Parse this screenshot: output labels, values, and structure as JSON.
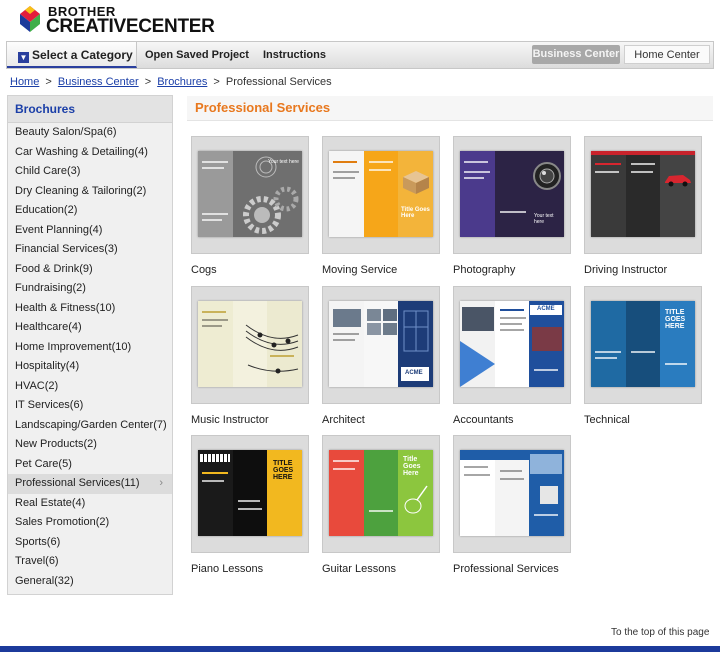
{
  "header": {
    "brand": "BROTHER",
    "product": "CREATIVECENTER"
  },
  "nav": {
    "select_category": "Select a Category",
    "open_saved": "Open Saved Project",
    "instructions": "Instructions",
    "business_center": "Business Center",
    "home_center": "Home Center"
  },
  "breadcrumb": {
    "home": "Home",
    "business": "Business Center",
    "brochures": "Brochures",
    "current": "Professional Services",
    "separator": ">"
  },
  "sidebar": {
    "title": "Brochures",
    "items": [
      {
        "label": "Beauty Salon/Spa(6)"
      },
      {
        "label": "Car Washing & Detailing(4)"
      },
      {
        "label": "Child Care(3)"
      },
      {
        "label": "Dry Cleaning & Tailoring(2)"
      },
      {
        "label": "Education(2)"
      },
      {
        "label": "Event Planning(4)"
      },
      {
        "label": "Financial Services(3)"
      },
      {
        "label": "Food & Drink(9)"
      },
      {
        "label": "Fundraising(2)"
      },
      {
        "label": "Health & Fitness(10)"
      },
      {
        "label": "Healthcare(4)"
      },
      {
        "label": "Home Improvement(10)"
      },
      {
        "label": "Hospitality(4)"
      },
      {
        "label": "HVAC(2)"
      },
      {
        "label": "IT Services(6)"
      },
      {
        "label": "Landscaping/Garden Center(7)"
      },
      {
        "label": "New Products(2)"
      },
      {
        "label": "Pet Care(5)"
      },
      {
        "label": "Professional Services(11)"
      },
      {
        "label": "Real Estate(4)"
      },
      {
        "label": "Sales Promotion(2)"
      },
      {
        "label": "Sports(6)"
      },
      {
        "label": "Travel(6)"
      },
      {
        "label": "General(32)"
      }
    ]
  },
  "main": {
    "title": "Professional Services",
    "templates": [
      {
        "label": "Cogs",
        "thumb_text": "Your text here"
      },
      {
        "label": "Moving Service",
        "thumb_text": "Title Goes Here"
      },
      {
        "label": "Photography",
        "thumb_text": "Your text here"
      },
      {
        "label": "Driving Instructor",
        "thumb_text": ""
      },
      {
        "label": "Music Instructor",
        "thumb_text": ""
      },
      {
        "label": "Architect",
        "thumb_text": "ACME"
      },
      {
        "label": "Accountants",
        "thumb_text": "ACME"
      },
      {
        "label": "Technical",
        "thumb_text": "TITLE GOES HERE"
      },
      {
        "label": "Piano Lessons",
        "thumb_text": "TITLE GOES HERE"
      },
      {
        "label": "Guitar Lessons",
        "thumb_text": "Title Goes Here"
      },
      {
        "label": "Professional Services",
        "thumb_text": ""
      }
    ]
  },
  "footer": {
    "note": "To the top of this page"
  }
}
